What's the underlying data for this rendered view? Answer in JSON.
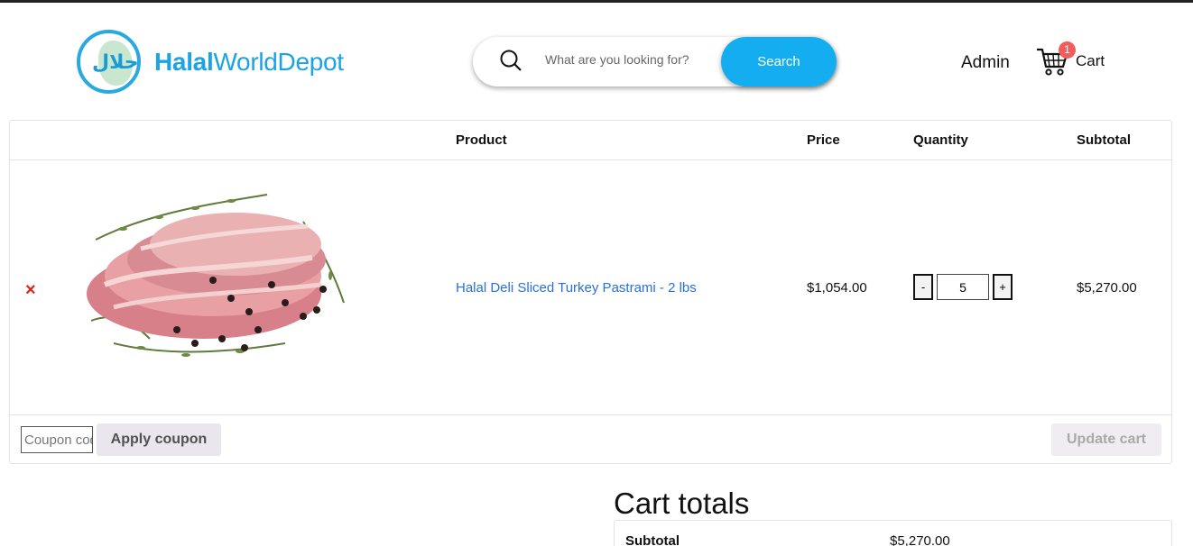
{
  "header": {
    "logo_bold": "Halal",
    "logo_rest": "WorldDepot",
    "logo_arabic": "حلال",
    "search_placeholder": "What are you looking for?",
    "search_button": "Search",
    "admin_label": "Admin",
    "cart_label": "Cart",
    "cart_count": "1"
  },
  "table": {
    "headers": {
      "product": "Product",
      "price": "Price",
      "quantity": "Quantity",
      "subtotal": "Subtotal"
    },
    "items": [
      {
        "remove": "×",
        "name": "Halal Deli Sliced Turkey Pastrami - 2 lbs",
        "price": "$1,054.00",
        "quantity": "5",
        "subtotal": "$5,270.00"
      }
    ],
    "qty_minus": "-",
    "qty_plus": "+",
    "coupon_placeholder": "Coupon code",
    "apply_coupon": "Apply coupon",
    "update_cart": "Update cart"
  },
  "totals": {
    "title": "Cart totals",
    "subtotal_label": "Subtotal",
    "subtotal_value": "$5,270.00"
  },
  "colors": {
    "brand": "#1aa3e6",
    "search_button": "#14aef0",
    "badge": "#f25c5c",
    "remove": "#e2231a",
    "link": "#2a6fdb"
  }
}
